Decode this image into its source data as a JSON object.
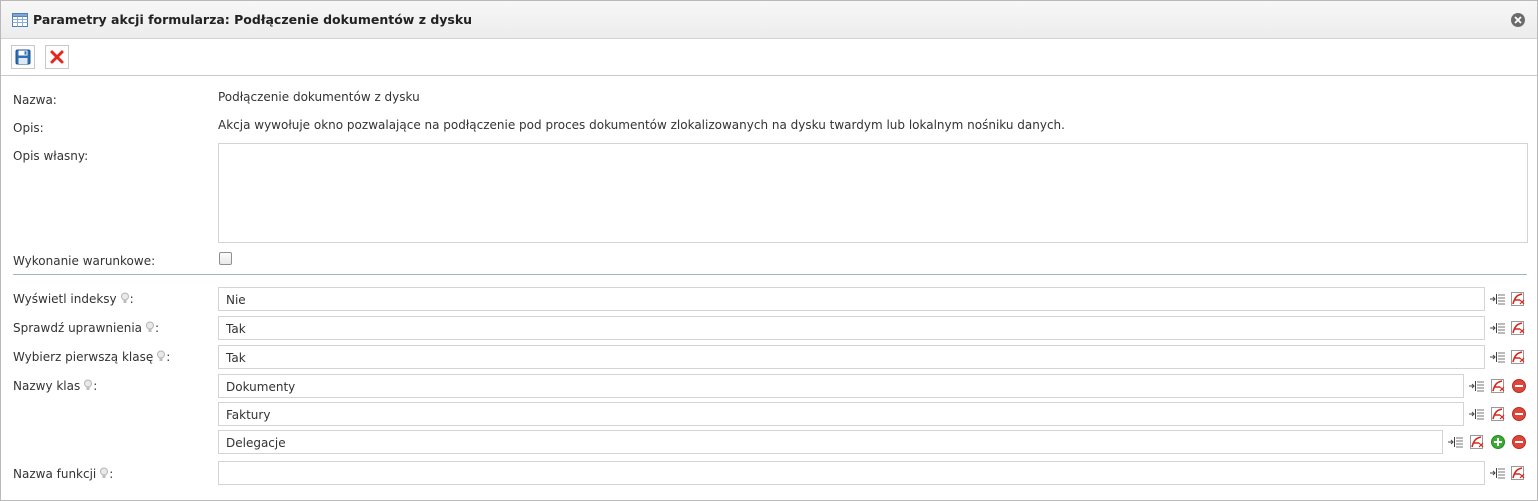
{
  "window": {
    "title": "Parametry akcji formularza: Podłączenie dokumentów z dysku",
    "icons": {
      "title": "table-icon",
      "close": "close-icon"
    }
  },
  "toolbar": {
    "buttons": [
      {
        "name": "save",
        "icon": "floppy-disk-icon"
      },
      {
        "name": "cancel",
        "icon": "red-x-icon"
      }
    ]
  },
  "form": {
    "name_label": "Nazwa:",
    "name_value": "Podłączenie dokumentów z dysku",
    "desc_label": "Opis:",
    "desc_value": "Akcja wywołuje okno pozwalające na podłączenie pod proces dokumentów zlokalizowanych na dysku twardym lub lokalnym nośniku danych.",
    "own_desc_label": "Opis własny:",
    "own_desc_value": "",
    "conditional_label": "Wykonanie warunkowe:",
    "conditional_checked": false
  },
  "params": {
    "show_indexes": {
      "label": "Wyświetl indeksy",
      "colon": ":",
      "value": "Nie"
    },
    "check_permissions": {
      "label": "Sprawdź uprawnienia",
      "colon": ":",
      "value": "Tak"
    },
    "choose_first_class": {
      "label": "Wybierz pierwszą klasę",
      "colon": ":",
      "value": "Tak"
    },
    "class_names": {
      "label": "Nazwy klas",
      "colon": ":",
      "values": [
        "Dokumenty",
        "Faktury",
        "Delegacje"
      ]
    },
    "function_name": {
      "label": "Nazwa funkcji",
      "colon": ":",
      "value": ""
    }
  },
  "colors": {
    "accent_line": "#9fb6c4",
    "remove": "#e0453a",
    "add": "#3aaa35"
  }
}
